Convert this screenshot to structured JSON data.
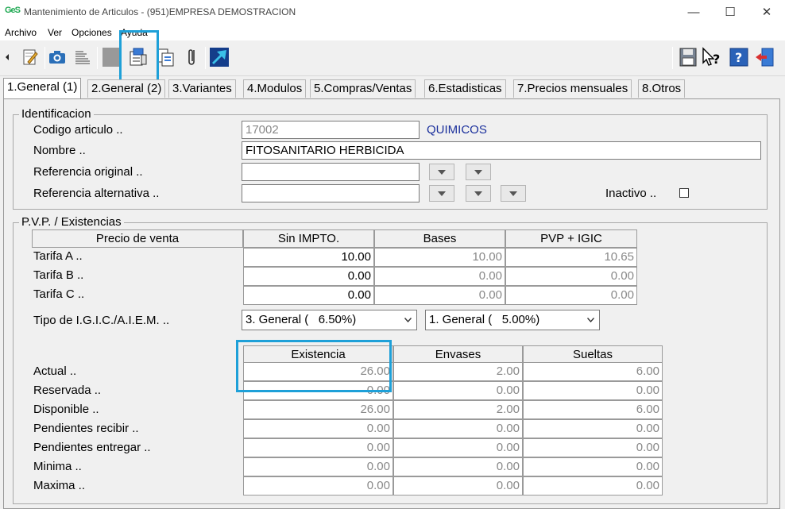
{
  "window": {
    "app_icon": "GeS",
    "title": "Mantenimiento de Articulos -  (951)EMPRESA DEMOSTRACION"
  },
  "menu": [
    "Archivo",
    "Ver",
    "Opciones",
    "Ayuda"
  ],
  "toolbar": {
    "icons": [
      "back-arrow-icon",
      "edit-note-icon",
      "camera-icon",
      "list-icon",
      "gray-block-icon",
      "copy-icon",
      "documents-icon",
      "paperclip-icon",
      "chart-icon",
      "save-icon",
      "whats-this-help-icon",
      "help-icon",
      "exit-door-icon"
    ]
  },
  "tabs": [
    "1.General (1)",
    "2.General (2)",
    "3.Variantes",
    "4.Modulos",
    "5.Compras/Ventas",
    "6.Estadisticas",
    "7.Precios mensuales",
    "8.Otros"
  ],
  "identificacion": {
    "title": "Identificacion",
    "codigo_label": "Codigo articulo ..",
    "codigo_value": "17002",
    "familia": "QUIMICOS",
    "nombre_label": "Nombre ..",
    "nombre_value": "FITOSANITARIO HERBICIDA",
    "ref_original_label": "Referencia original ..",
    "ref_original_value": "",
    "ref_alternativa_label": "Referencia alternativa ..",
    "ref_alternativa_value": "",
    "inactivo_label": "Inactivo .."
  },
  "pvp": {
    "title": "P.V.P. / Existencias",
    "headers": [
      "Precio de venta",
      "Sin IMPTO.",
      "Bases",
      "PVP + IGIC"
    ],
    "rows": [
      {
        "label": "Tarifa A ..",
        "sin_impto": "10.00",
        "bases": "10.00",
        "pvp_igic": "10.65"
      },
      {
        "label": "Tarifa B ..",
        "sin_impto": "0.00",
        "bases": "0.00",
        "pvp_igic": "0.00"
      },
      {
        "label": "Tarifa C ..",
        "sin_impto": "0.00",
        "bases": "0.00",
        "pvp_igic": "0.00"
      }
    ],
    "tipo_label": "Tipo de I.G.I.C./A.I.E.M. ..",
    "tipo_igic": "3. General (   6.50%)",
    "tipo_aiem": "1. General (   5.00%)"
  },
  "existencias": {
    "headers": [
      "Existencia",
      "Envases",
      "Sueltas"
    ],
    "rows": [
      {
        "label": "Actual ..",
        "existencia": "26.00",
        "envases": "2.00",
        "sueltas": "6.00"
      },
      {
        "label": "Reservada ..",
        "existencia": "0.00",
        "envases": "0.00",
        "sueltas": "0.00"
      },
      {
        "label": "Disponible ..",
        "existencia": "26.00",
        "envases": "2.00",
        "sueltas": "6.00"
      },
      {
        "label": "Pendientes recibir ..",
        "existencia": "0.00",
        "envases": "0.00",
        "sueltas": "0.00"
      },
      {
        "label": "Pendientes entregar ..",
        "existencia": "0.00",
        "envases": "0.00",
        "sueltas": "0.00"
      },
      {
        "label": "Minima ..",
        "existencia": "0.00",
        "envases": "0.00",
        "sueltas": "0.00"
      },
      {
        "label": "Maxima ..",
        "existencia": "0.00",
        "envases": "0.00",
        "sueltas": "0.00"
      }
    ]
  },
  "colors": {
    "highlight": "#1ea0d8",
    "familia_text": "#1a2f9c"
  }
}
